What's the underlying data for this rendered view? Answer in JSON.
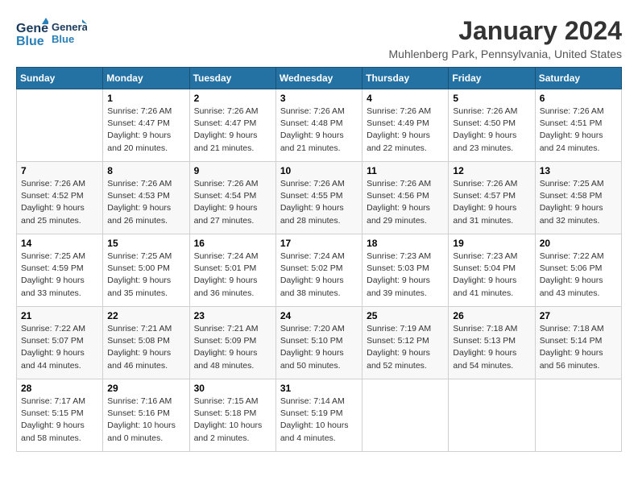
{
  "header": {
    "logo_general": "General",
    "logo_blue": "Blue",
    "month": "January 2024",
    "location": "Muhlenberg Park, Pennsylvania, United States"
  },
  "weekdays": [
    "Sunday",
    "Monday",
    "Tuesday",
    "Wednesday",
    "Thursday",
    "Friday",
    "Saturday"
  ],
  "weeks": [
    [
      {
        "day": "",
        "info": ""
      },
      {
        "day": "1",
        "info": "Sunrise: 7:26 AM\nSunset: 4:47 PM\nDaylight: 9 hours\nand 20 minutes."
      },
      {
        "day": "2",
        "info": "Sunrise: 7:26 AM\nSunset: 4:47 PM\nDaylight: 9 hours\nand 21 minutes."
      },
      {
        "day": "3",
        "info": "Sunrise: 7:26 AM\nSunset: 4:48 PM\nDaylight: 9 hours\nand 21 minutes."
      },
      {
        "day": "4",
        "info": "Sunrise: 7:26 AM\nSunset: 4:49 PM\nDaylight: 9 hours\nand 22 minutes."
      },
      {
        "day": "5",
        "info": "Sunrise: 7:26 AM\nSunset: 4:50 PM\nDaylight: 9 hours\nand 23 minutes."
      },
      {
        "day": "6",
        "info": "Sunrise: 7:26 AM\nSunset: 4:51 PM\nDaylight: 9 hours\nand 24 minutes."
      }
    ],
    [
      {
        "day": "7",
        "info": "Sunrise: 7:26 AM\nSunset: 4:52 PM\nDaylight: 9 hours\nand 25 minutes."
      },
      {
        "day": "8",
        "info": "Sunrise: 7:26 AM\nSunset: 4:53 PM\nDaylight: 9 hours\nand 26 minutes."
      },
      {
        "day": "9",
        "info": "Sunrise: 7:26 AM\nSunset: 4:54 PM\nDaylight: 9 hours\nand 27 minutes."
      },
      {
        "day": "10",
        "info": "Sunrise: 7:26 AM\nSunset: 4:55 PM\nDaylight: 9 hours\nand 28 minutes."
      },
      {
        "day": "11",
        "info": "Sunrise: 7:26 AM\nSunset: 4:56 PM\nDaylight: 9 hours\nand 29 minutes."
      },
      {
        "day": "12",
        "info": "Sunrise: 7:26 AM\nSunset: 4:57 PM\nDaylight: 9 hours\nand 31 minutes."
      },
      {
        "day": "13",
        "info": "Sunrise: 7:25 AM\nSunset: 4:58 PM\nDaylight: 9 hours\nand 32 minutes."
      }
    ],
    [
      {
        "day": "14",
        "info": "Sunrise: 7:25 AM\nSunset: 4:59 PM\nDaylight: 9 hours\nand 33 minutes."
      },
      {
        "day": "15",
        "info": "Sunrise: 7:25 AM\nSunset: 5:00 PM\nDaylight: 9 hours\nand 35 minutes."
      },
      {
        "day": "16",
        "info": "Sunrise: 7:24 AM\nSunset: 5:01 PM\nDaylight: 9 hours\nand 36 minutes."
      },
      {
        "day": "17",
        "info": "Sunrise: 7:24 AM\nSunset: 5:02 PM\nDaylight: 9 hours\nand 38 minutes."
      },
      {
        "day": "18",
        "info": "Sunrise: 7:23 AM\nSunset: 5:03 PM\nDaylight: 9 hours\nand 39 minutes."
      },
      {
        "day": "19",
        "info": "Sunrise: 7:23 AM\nSunset: 5:04 PM\nDaylight: 9 hours\nand 41 minutes."
      },
      {
        "day": "20",
        "info": "Sunrise: 7:22 AM\nSunset: 5:06 PM\nDaylight: 9 hours\nand 43 minutes."
      }
    ],
    [
      {
        "day": "21",
        "info": "Sunrise: 7:22 AM\nSunset: 5:07 PM\nDaylight: 9 hours\nand 44 minutes."
      },
      {
        "day": "22",
        "info": "Sunrise: 7:21 AM\nSunset: 5:08 PM\nDaylight: 9 hours\nand 46 minutes."
      },
      {
        "day": "23",
        "info": "Sunrise: 7:21 AM\nSunset: 5:09 PM\nDaylight: 9 hours\nand 48 minutes."
      },
      {
        "day": "24",
        "info": "Sunrise: 7:20 AM\nSunset: 5:10 PM\nDaylight: 9 hours\nand 50 minutes."
      },
      {
        "day": "25",
        "info": "Sunrise: 7:19 AM\nSunset: 5:12 PM\nDaylight: 9 hours\nand 52 minutes."
      },
      {
        "day": "26",
        "info": "Sunrise: 7:18 AM\nSunset: 5:13 PM\nDaylight: 9 hours\nand 54 minutes."
      },
      {
        "day": "27",
        "info": "Sunrise: 7:18 AM\nSunset: 5:14 PM\nDaylight: 9 hours\nand 56 minutes."
      }
    ],
    [
      {
        "day": "28",
        "info": "Sunrise: 7:17 AM\nSunset: 5:15 PM\nDaylight: 9 hours\nand 58 minutes."
      },
      {
        "day": "29",
        "info": "Sunrise: 7:16 AM\nSunset: 5:16 PM\nDaylight: 10 hours\nand 0 minutes."
      },
      {
        "day": "30",
        "info": "Sunrise: 7:15 AM\nSunset: 5:18 PM\nDaylight: 10 hours\nand 2 minutes."
      },
      {
        "day": "31",
        "info": "Sunrise: 7:14 AM\nSunset: 5:19 PM\nDaylight: 10 hours\nand 4 minutes."
      },
      {
        "day": "",
        "info": ""
      },
      {
        "day": "",
        "info": ""
      },
      {
        "day": "",
        "info": ""
      }
    ]
  ]
}
